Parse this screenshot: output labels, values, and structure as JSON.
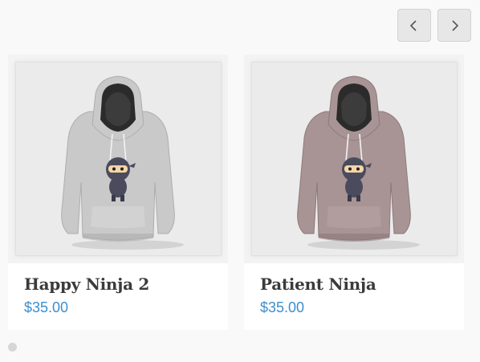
{
  "carousel": {
    "prev_icon": "chevron-left-icon",
    "next_icon": "chevron-right-icon",
    "dots": 1
  },
  "products": [
    {
      "name": "Happy Ninja 2",
      "price": "$35.00",
      "hoodie_color": "#c9c9c9",
      "image": "grey-hoodie-ninja-image"
    },
    {
      "name": "Patient Ninja",
      "price": "$35.00",
      "hoodie_color": "#a99495",
      "image": "mauve-hoodie-ninja-image"
    }
  ],
  "colors": {
    "price": "#3b8fce",
    "title": "#3b3b3b",
    "background": "#f9f9f9"
  }
}
